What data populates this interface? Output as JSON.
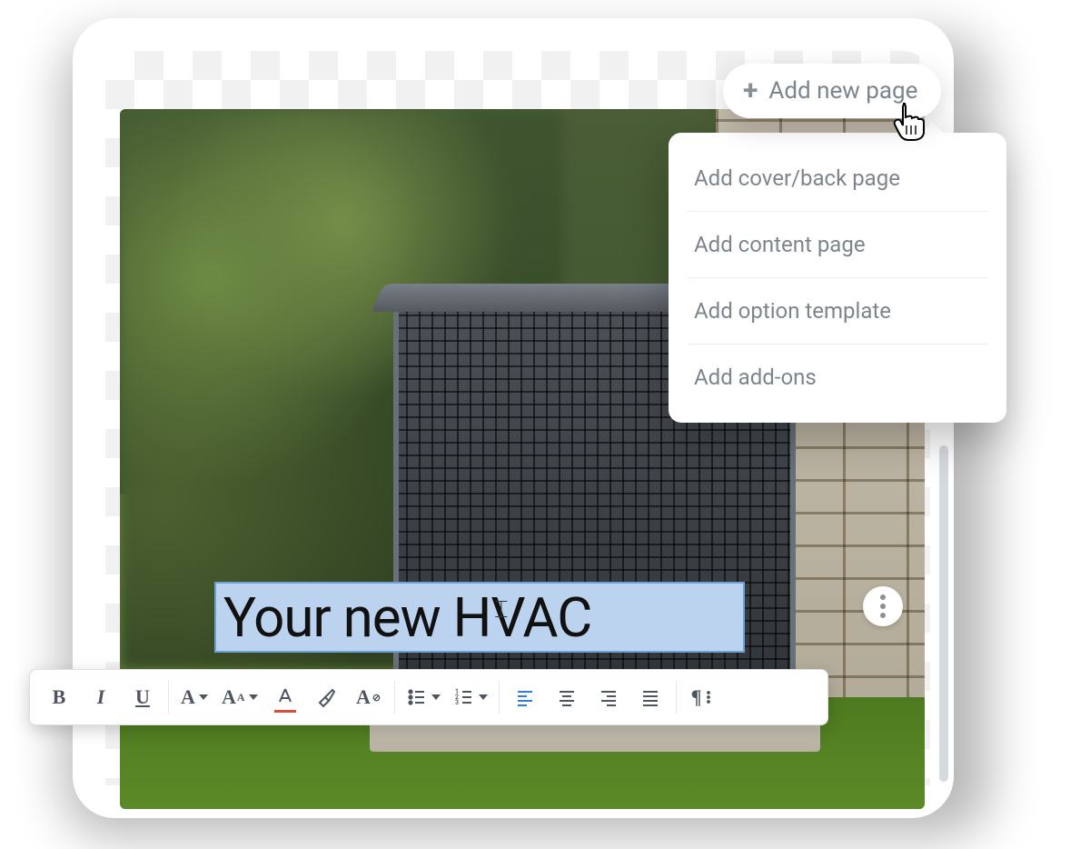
{
  "addButton": {
    "label": "Add new page"
  },
  "dropdown": {
    "items": [
      "Add cover/back page",
      "Add content page",
      "Add option template",
      "Add add-ons"
    ]
  },
  "textBox": {
    "value": "Your new HVAC"
  },
  "toolbar": {
    "bold": "B",
    "italic": "I",
    "underline": "U"
  }
}
